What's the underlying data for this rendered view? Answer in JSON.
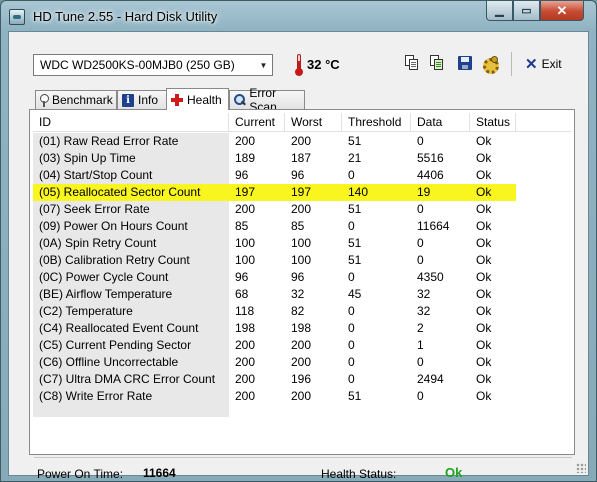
{
  "window": {
    "title": "HD Tune 2.55 - Hard Disk Utility",
    "controls": {
      "minimize": "▁",
      "maximize": "▭",
      "close": "✕"
    }
  },
  "toolbar": {
    "drive": "WDC WD2500KS-00MJB0 (250 GB)",
    "temperature": "32 °C",
    "tools": [
      "copy-text-icon",
      "copy-screenshot-icon",
      "save-icon",
      "options-icon"
    ],
    "exit_label": "Exit"
  },
  "tabs": [
    {
      "label": "Benchmark",
      "icon": "benchmark-gauge-icon"
    },
    {
      "label": "Info",
      "icon": "info-icon"
    },
    {
      "label": "Health",
      "icon": "health-cross-icon",
      "active": true
    },
    {
      "label": "Error Scan",
      "icon": "magnifier-icon"
    }
  ],
  "table": {
    "columns": [
      "ID",
      "Current",
      "Worst",
      "Threshold",
      "Data",
      "Status"
    ],
    "rows": [
      {
        "id": "(01) Raw Read Error Rate",
        "current": "200",
        "worst": "200",
        "threshold": "51",
        "data": "0",
        "status": "Ok"
      },
      {
        "id": "(03) Spin Up Time",
        "current": "189",
        "worst": "187",
        "threshold": "21",
        "data": "5516",
        "status": "Ok"
      },
      {
        "id": "(04) Start/Stop Count",
        "current": "96",
        "worst": "96",
        "threshold": "0",
        "data": "4406",
        "status": "Ok"
      },
      {
        "id": "(05) Reallocated Sector Count",
        "current": "197",
        "worst": "197",
        "threshold": "140",
        "data": "19",
        "status": "Ok",
        "highlight": true
      },
      {
        "id": "(07) Seek Error Rate",
        "current": "200",
        "worst": "200",
        "threshold": "51",
        "data": "0",
        "status": "Ok"
      },
      {
        "id": "(09) Power On Hours Count",
        "current": "85",
        "worst": "85",
        "threshold": "0",
        "data": "11664",
        "status": "Ok"
      },
      {
        "id": "(0A) Spin Retry Count",
        "current": "100",
        "worst": "100",
        "threshold": "51",
        "data": "0",
        "status": "Ok"
      },
      {
        "id": "(0B) Calibration Retry Count",
        "current": "100",
        "worst": "100",
        "threshold": "51",
        "data": "0",
        "status": "Ok"
      },
      {
        "id": "(0C) Power Cycle Count",
        "current": "96",
        "worst": "96",
        "threshold": "0",
        "data": "4350",
        "status": "Ok"
      },
      {
        "id": "(BE) Airflow Temperature",
        "current": "68",
        "worst": "32",
        "threshold": "45",
        "data": "32",
        "status": "Ok"
      },
      {
        "id": "(C2) Temperature",
        "current": "118",
        "worst": "82",
        "threshold": "0",
        "data": "32",
        "status": "Ok"
      },
      {
        "id": "(C4) Reallocated Event Count",
        "current": "198",
        "worst": "198",
        "threshold": "0",
        "data": "2",
        "status": "Ok"
      },
      {
        "id": "(C5) Current Pending Sector",
        "current": "200",
        "worst": "200",
        "threshold": "0",
        "data": "1",
        "status": "Ok"
      },
      {
        "id": "(C6) Offline Uncorrectable",
        "current": "200",
        "worst": "200",
        "threshold": "0",
        "data": "0",
        "status": "Ok"
      },
      {
        "id": "(C7) Ultra DMA CRC Error Count",
        "current": "200",
        "worst": "196",
        "threshold": "0",
        "data": "2494",
        "status": "Ok"
      },
      {
        "id": "(C8) Write Error Rate",
        "current": "200",
        "worst": "200",
        "threshold": "51",
        "data": "0",
        "status": "Ok"
      }
    ]
  },
  "footer": {
    "power_on_label": "Power On Time:",
    "power_on_value": "11664",
    "health_label": "Health Status:",
    "health_value": "Ok"
  },
  "colors": {
    "highlight": "#f8f61e",
    "ok": "#1fa31f",
    "close": "#c74b32"
  }
}
